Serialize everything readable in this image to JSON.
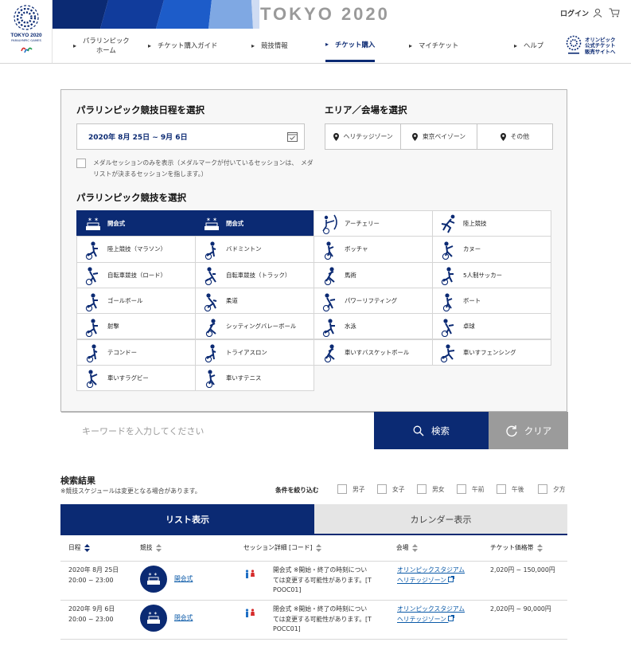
{
  "header": {
    "logo_text": "TOKYO 2020",
    "logo_sub": "PARALYMPIC GAMES",
    "banner_title": "TOKYO 2020",
    "login": "ログイン",
    "nav": [
      {
        "label": "パラリンピック\nホーム",
        "active": false
      },
      {
        "label": "チケット購入ガイド",
        "active": false
      },
      {
        "label": "競技情報",
        "active": false
      },
      {
        "label": "チケット購入",
        "active": true
      },
      {
        "label": "マイチケット",
        "active": false
      },
      {
        "label": "ヘルプ",
        "active": false
      }
    ],
    "external_link": "オリンピック\n公式チケット\n販売サイトへ"
  },
  "search": {
    "schedule_title": "パラリンピック競技日程を選択",
    "date_range": "2020年 8月 25日 ~ 9月 6日",
    "area_title": "エリア／会場を選択",
    "areas": [
      "ヘリテッジゾーン",
      "東京ベイゾーン",
      "その他"
    ],
    "medal_label": "メダルセッションのみを表示（メダルマークが付いているセッションは、　メダリストが決まるセッションを指します。）",
    "sport_title": "パラリンピック競技を選択",
    "sports": [
      {
        "label": "開会式",
        "selected": true,
        "icon": "ceremony-icon"
      },
      {
        "label": "閉会式",
        "selected": true,
        "icon": "ceremony-icon"
      },
      {
        "label": "アーチェリー",
        "selected": false,
        "icon": "archery-icon"
      },
      {
        "label": "陸上競技",
        "selected": false,
        "icon": "athletics-icon"
      },
      {
        "label": "陸上競技（マラソン）",
        "selected": false,
        "icon": "marathon-icon"
      },
      {
        "label": "バドミントン",
        "selected": false,
        "icon": "badminton-icon"
      },
      {
        "label": "ボッチャ",
        "selected": false,
        "icon": "boccia-icon"
      },
      {
        "label": "カヌー",
        "selected": false,
        "icon": "canoe-icon"
      },
      {
        "label": "自転車競技（ロード）",
        "selected": false,
        "icon": "cycling-road-icon"
      },
      {
        "label": "自転車競技（トラック）",
        "selected": false,
        "icon": "cycling-track-icon"
      },
      {
        "label": "馬術",
        "selected": false,
        "icon": "equestrian-icon"
      },
      {
        "label": "5人制サッカー",
        "selected": false,
        "icon": "football-icon"
      },
      {
        "label": "ゴールボール",
        "selected": false,
        "icon": "goalball-icon"
      },
      {
        "label": "柔道",
        "selected": false,
        "icon": "judo-icon"
      },
      {
        "label": "パワーリフティング",
        "selected": false,
        "icon": "powerlifting-icon"
      },
      {
        "label": "ボート",
        "selected": false,
        "icon": "rowing-icon"
      },
      {
        "label": "射撃",
        "selected": false,
        "icon": "shooting-icon"
      },
      {
        "label": "シッティングバレーボール",
        "selected": false,
        "icon": "volleyball-icon"
      },
      {
        "label": "水泳",
        "selected": false,
        "icon": "swimming-icon"
      },
      {
        "label": "卓球",
        "selected": false,
        "icon": "table-tennis-icon"
      },
      {
        "label": "テコンドー",
        "selected": false,
        "icon": "taekwondo-icon"
      },
      {
        "label": "トライアスロン",
        "selected": false,
        "icon": "triathlon-icon"
      },
      {
        "label": "車いすバスケットボール",
        "selected": false,
        "icon": "basketball-icon"
      },
      {
        "label": "車いすフェンシング",
        "selected": false,
        "icon": "fencing-icon"
      },
      {
        "label": "車いすラグビー",
        "selected": false,
        "icon": "rugby-icon"
      },
      {
        "label": "車いすテニス",
        "selected": false,
        "icon": "tennis-icon"
      }
    ],
    "keyword_placeholder": "キーワードを入力してください",
    "search_button": "検索",
    "clear_button": "クリア"
  },
  "results": {
    "title": "検索結果",
    "note": "※競技スケジュールは変更となる場合があります。",
    "filter_label": "条件を絞り込む",
    "filters": [
      "男子",
      "女子",
      "男女",
      "午前",
      "午後",
      "夕方"
    ],
    "tab_list": "リスト表示",
    "tab_calendar": "カレンダー表示",
    "columns": [
      "日程",
      "競技",
      "セッション詳細 [コード]",
      "会場",
      "チケット価格帯"
    ],
    "rows": [
      {
        "date": "2020年 8月 25日",
        "time": "20:00 ~ 23:00",
        "sport": "開会式",
        "detail": "開会式 ※開始・終了の時刻につい\nては変更する可能性があります。[T\nPOOC01]",
        "venue": "オリンピックスタジアム",
        "zone": "ヘリテッジゾーン",
        "price": "2,020円 ~ 150,000円"
      },
      {
        "date": "2020年 9月 6日",
        "time": "20:00 ~ 23:00",
        "sport": "閉会式",
        "detail": "閉会式 ※開始・終了の時刻につい\nては変更する可能性があります。[T\nPOCC01]",
        "venue": "オリンピックスタジアム",
        "zone": "ヘリテッジゾーン",
        "price": "2,020円 ~ 90,000円"
      }
    ]
  },
  "colors": {
    "brand_navy": "#0b2a73",
    "clear_gray": "#9b9b9b",
    "link_blue": "#0b5aa8"
  }
}
